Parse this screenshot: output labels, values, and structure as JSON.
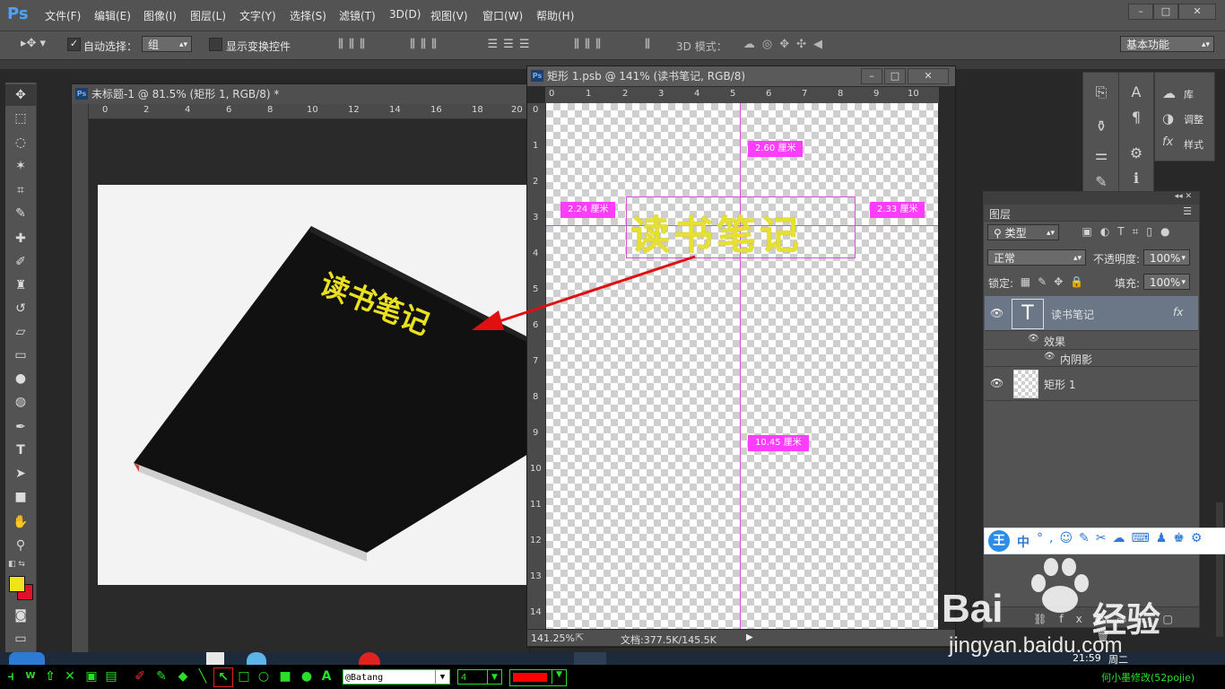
{
  "app": {
    "logo": "Ps"
  },
  "menu": [
    "文件(F)",
    "编辑(E)",
    "图像(I)",
    "图层(L)",
    "文字(Y)",
    "选择(S)",
    "滤镜(T)",
    "3D(D)",
    "视图(V)",
    "窗口(W)",
    "帮助(H)"
  ],
  "window_buttons": [
    "–",
    "□",
    "✕"
  ],
  "options": {
    "auto_select_label": "自动选择：",
    "auto_select_value": "组",
    "show_transform_label": "显示变换控件",
    "mode_3d_label": "3D 模式：",
    "workspace": "基本功能"
  },
  "doc1": {
    "title": "未标题-1 @ 81.5% (矩形 1, RGB/8) *",
    "ruler": [
      "0",
      "2",
      "4",
      "6",
      "8",
      "10",
      "12",
      "14",
      "16",
      "18",
      "20"
    ],
    "book_text": "读书笔记"
  },
  "doc2": {
    "title": "矩形 1.psb @ 141% (读书笔记, RGB/8)",
    "ruler_h": [
      "0",
      "1",
      "2",
      "3",
      "4",
      "5",
      "6",
      "7",
      "8",
      "9",
      "10"
    ],
    "ruler_v": [
      "0",
      "1",
      "2",
      "3",
      "4",
      "5",
      "6",
      "7",
      "8",
      "9",
      "10",
      "11",
      "12",
      "13",
      "14"
    ],
    "text": "读书笔记",
    "measures": {
      "top": "2.60 厘米",
      "left": "2.24 厘米",
      "right": "2.33 厘米",
      "bottom": "10.45 厘米"
    },
    "zoom": "141.25%",
    "doc_info": "文档:377.5K/145.5K"
  },
  "panels": {
    "library": "库",
    "adjust": "调整",
    "style": "样式"
  },
  "layers": {
    "tab": "图层",
    "kind": "类型",
    "blend": "正常",
    "opacity_label": "不透明度:",
    "opacity": "100%",
    "lock_label": "锁定:",
    "fill_label": "填充:",
    "fill": "100%",
    "items": [
      {
        "name": "读书笔记",
        "fx": "fx"
      },
      {
        "name": "矩形 1"
      }
    ],
    "effects_label": "效果",
    "effect_name": "内阴影"
  },
  "ime": {
    "logo": "王",
    "mode": "中"
  },
  "watermark": {
    "brand_a": "Bai",
    "brand_b": "经验",
    "url": "jingyan.baidu.com"
  },
  "bottombar": {
    "font": "@Batang",
    "size": "4",
    "credit": "何小墨修改(52pojie)"
  },
  "clock": {
    "time": "21:59",
    "day": "周二"
  }
}
